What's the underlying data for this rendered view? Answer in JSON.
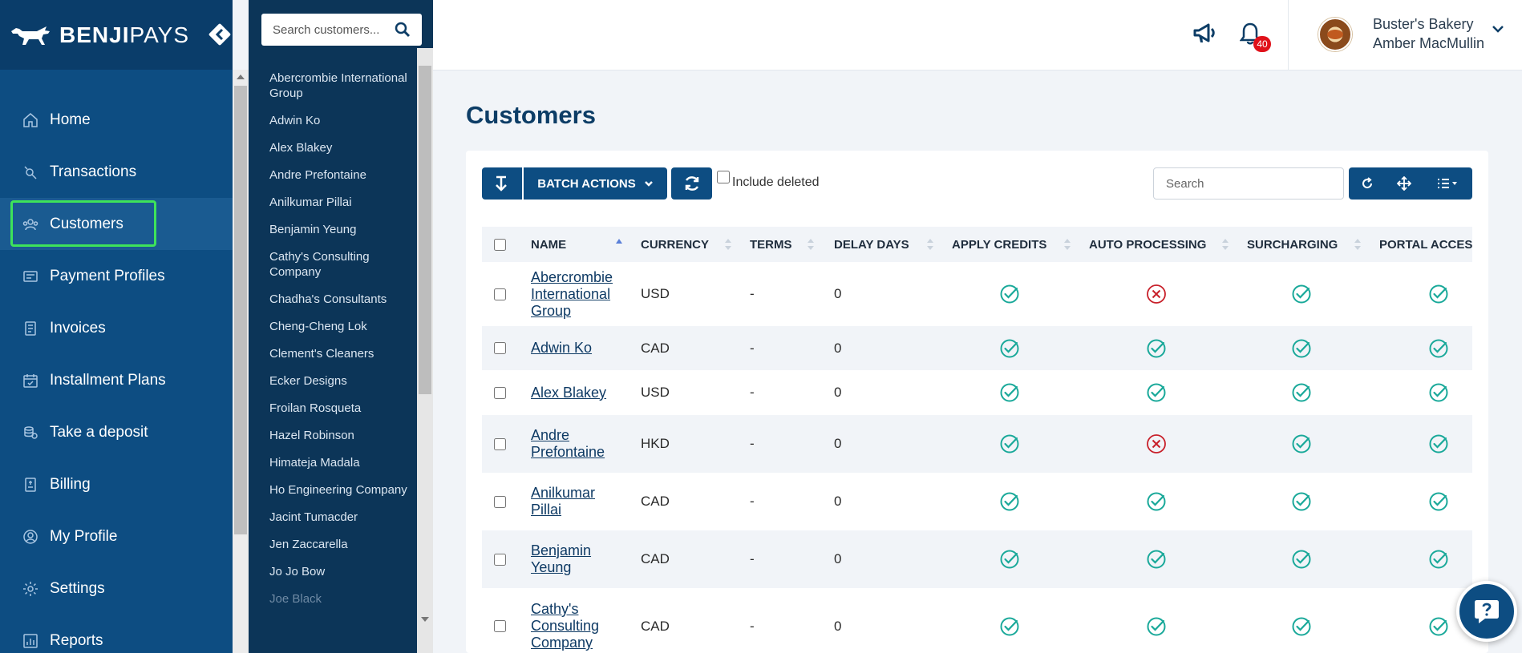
{
  "brand": {
    "name_bold": "BENJI",
    "name_light": "PAYS"
  },
  "nav": {
    "items": [
      {
        "label": "Home",
        "icon": "home-icon"
      },
      {
        "label": "Transactions",
        "icon": "transactions-icon"
      },
      {
        "label": "Customers",
        "icon": "customers-icon",
        "active": true
      },
      {
        "label": "Payment Profiles",
        "icon": "payment-profiles-icon"
      },
      {
        "label": "Invoices",
        "icon": "invoices-icon"
      },
      {
        "label": "Installment Plans",
        "icon": "calendar-icon"
      },
      {
        "label": "Take a deposit",
        "icon": "deposit-icon"
      },
      {
        "label": "Billing",
        "icon": "billing-icon"
      },
      {
        "label": "My Profile",
        "icon": "profile-icon"
      },
      {
        "label": "Settings",
        "icon": "gear-icon"
      },
      {
        "label": "Reports",
        "icon": "reports-icon"
      }
    ]
  },
  "customer_panel": {
    "search_placeholder": "Search customers...",
    "customers": [
      "Abercrombie International Group",
      "Adwin Ko",
      "Alex Blakey",
      "Andre Prefontaine",
      "Anilkumar Pillai",
      "Benjamin Yeung",
      "Cathy's Consulting Company",
      "Chadha's Consultants",
      "Cheng-Cheng Lok",
      "Clement's Cleaners",
      "Ecker Designs",
      "Froilan Rosqueta",
      "Hazel Robinson",
      "Himateja Madala",
      "Ho Engineering Company",
      "Jacint Tumacder",
      "Jen Zaccarella",
      "Jo Jo Bow",
      "Joe Black"
    ]
  },
  "header": {
    "notification_count": "40",
    "org_name": "Buster's Bakery",
    "user_name": "Amber MacMullin"
  },
  "page": {
    "title": "Customers"
  },
  "toolbar": {
    "batch_actions_label": "BATCH ACTIONS",
    "include_deleted_label": "Include deleted",
    "search_placeholder": "Search"
  },
  "table": {
    "columns": [
      "NAME",
      "CURRENCY",
      "TERMS",
      "DELAY DAYS",
      "APPLY CREDITS",
      "AUTO PROCESSING",
      "SURCHARGING",
      "PORTAL ACCESS"
    ],
    "rows": [
      {
        "name": "Abercrombie International Group",
        "currency": "USD",
        "terms": "-",
        "delay_days": "0",
        "apply_credits": true,
        "auto_processing": false,
        "surcharging": true,
        "portal_access": true
      },
      {
        "name": "Adwin Ko",
        "currency": "CAD",
        "terms": "-",
        "delay_days": "0",
        "apply_credits": true,
        "auto_processing": true,
        "surcharging": true,
        "portal_access": true
      },
      {
        "name": "Alex Blakey",
        "currency": "USD",
        "terms": "-",
        "delay_days": "0",
        "apply_credits": true,
        "auto_processing": true,
        "surcharging": true,
        "portal_access": true
      },
      {
        "name": "Andre Prefontaine",
        "currency": "HKD",
        "terms": "-",
        "delay_days": "0",
        "apply_credits": true,
        "auto_processing": false,
        "surcharging": true,
        "portal_access": true
      },
      {
        "name": "Anilkumar Pillai",
        "currency": "CAD",
        "terms": "-",
        "delay_days": "0",
        "apply_credits": true,
        "auto_processing": true,
        "surcharging": true,
        "portal_access": true
      },
      {
        "name": "Benjamin Yeung",
        "currency": "CAD",
        "terms": "-",
        "delay_days": "0",
        "apply_credits": true,
        "auto_processing": true,
        "surcharging": true,
        "portal_access": true
      },
      {
        "name": "Cathy's Consulting Company",
        "currency": "CAD",
        "terms": "-",
        "delay_days": "0",
        "apply_credits": true,
        "auto_processing": true,
        "surcharging": true,
        "portal_access": true
      }
    ]
  },
  "colors": {
    "primary": "#0d4d82",
    "sidebar_dark": "#0a3d6a",
    "panel": "#0c3558",
    "check": "#1aa99a",
    "cross": "#c8202a",
    "highlight": "#3ee35a"
  }
}
